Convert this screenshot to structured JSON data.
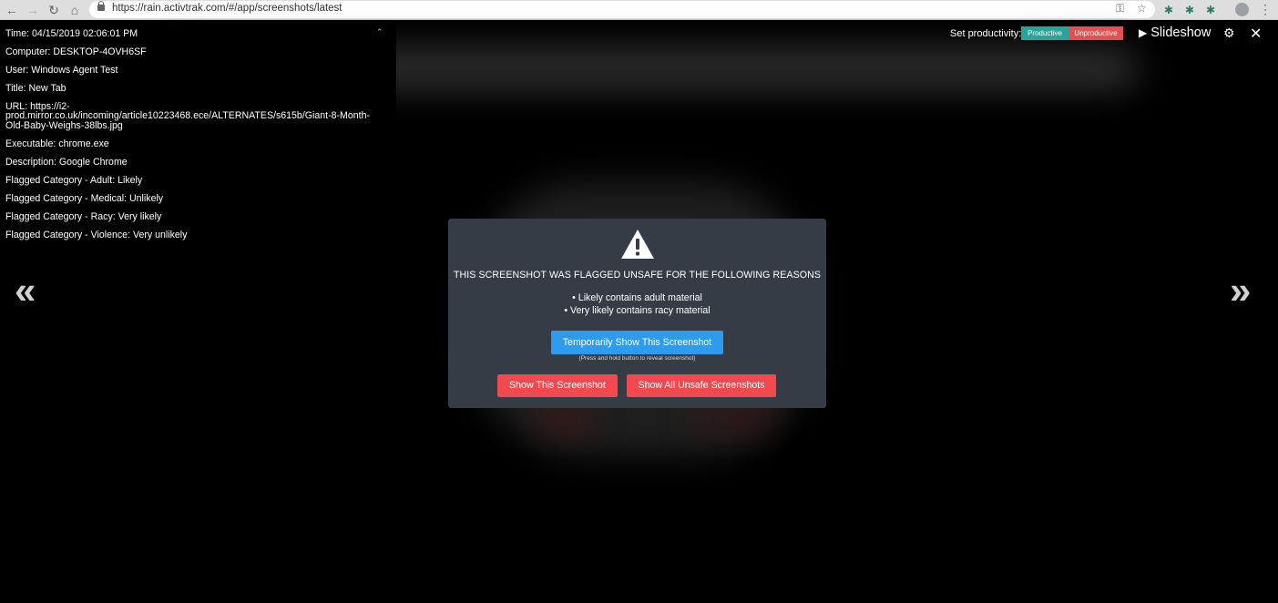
{
  "browser": {
    "url": "https://rain.activtrak.com/#/app/screenshots/latest"
  },
  "info": {
    "time": "Time: 04/15/2019 02:06:01 PM",
    "computer": "Computer: DESKTOP-4OVH6SF",
    "user": "User: Windows Agent Test",
    "title": "Title: New Tab",
    "url_line1": "URL: https://i2-",
    "url_line2": "prod.mirror.co.uk/incoming/article10223468.ece/ALTERNATES/s615b/Giant-8-Month-",
    "url_line3": "Old-Baby-Weighs-38lbs.jpg",
    "executable": "Executable: chrome.exe",
    "description": "Description: Google Chrome",
    "flag_adult": "Flagged Category - Adult: Likely",
    "flag_medical": "Flagged Category - Medical: Unlikely",
    "flag_racy": "Flagged Category - Racy: Very likely",
    "flag_violence": "Flagged Category - Violence: Very unlikely"
  },
  "toolbar": {
    "productivity_label": "Set productivity:",
    "productive_label": "Productive",
    "unproductive_label": "Unproductive",
    "slideshow_label": "Slideshow",
    "productive_color": "#26a69a",
    "unproductive_color": "#e35050"
  },
  "modal": {
    "title": "THIS SCREENSHOT WAS FLAGGED UNSAFE FOR THE FOLLOWING REASONS",
    "reasons": [
      "• Likely contains adult material",
      "• Very likely contains racy material"
    ],
    "temp_button": "Temporarily Show This Screenshot",
    "hint": "(Press and hold button to reveal screenshot)",
    "show_button": "Show This Screenshot",
    "show_all_button": "Show All Unsafe Screenshots"
  },
  "icons": {
    "prev": "«",
    "next": "»"
  }
}
